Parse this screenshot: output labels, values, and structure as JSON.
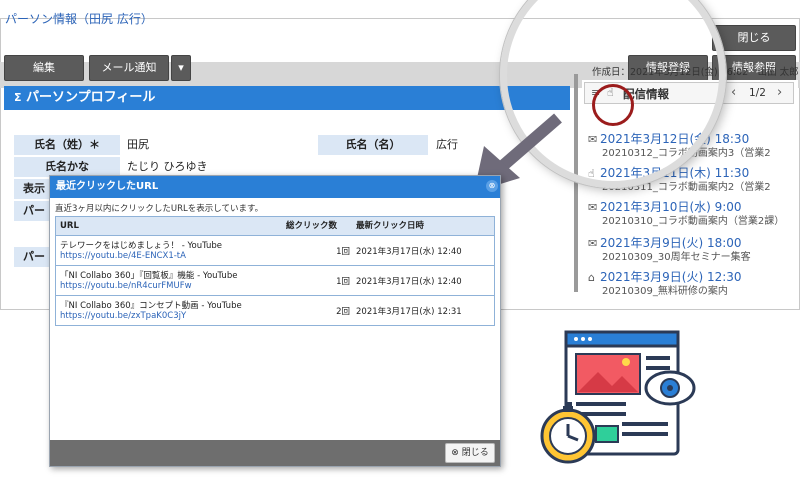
{
  "page": {
    "title": "パーソン情報（田尻 広行）"
  },
  "header": {
    "close_label": "閉じる",
    "edit_label": "編集",
    "mail_label": "メール通知",
    "info_register_label": "情報登録",
    "info_view_label": "情報参照"
  },
  "profile": {
    "heading": "パーソンプロフィール",
    "last_name_label": "氏名（姓）＊",
    "last_name_value": "田尻",
    "first_name_label": "氏名（名）",
    "first_name_value": "広行",
    "kana_label": "氏名かな",
    "kana_value": "たじり ひろゆき",
    "display_label": "表示",
    "p_label_1": "パー",
    "p_label_2": "パー"
  },
  "right_panel": {
    "updated": "作成日：2021年3月12日(金) 16:02　山田 太郎",
    "title": "配信情報",
    "page": "1/2",
    "items": [
      {
        "icon": "mail-icon",
        "time": "2021年3月12日(金) 18:30",
        "sub": "20210312_コラボ動画案内3（営業2"
      },
      {
        "icon": "click-icon",
        "time": "2021年3月11日(木) 11:30",
        "sub": "20210311_コラボ動画案内2（営業2"
      },
      {
        "icon": "mail-icon",
        "time": "2021年3月10日(水) 9:00",
        "sub": "20210310_コラボ動画案内（営業2課）"
      },
      {
        "icon": "mail-icon",
        "time": "2021年3月9日(火) 18:00",
        "sub": "20210309_30周年セミナー集客"
      },
      {
        "icon": "open-mail-icon",
        "time": "2021年3月9日(火) 12:30",
        "sub": "20210309_無料研修の案内"
      }
    ]
  },
  "modal": {
    "title": "最近クリックしたURL",
    "description": "直近3ヶ月以内にクリックしたURLを表示しています。",
    "columns": {
      "url": "URL",
      "count": "総クリック数",
      "date": "最新クリック日時"
    },
    "rows": [
      {
        "title": "テレワークをはじめましょう！ - YouTube",
        "url": "https://youtu.be/4E-ENCX1-tA",
        "count": "1回",
        "date": "2021年3月17日(水) 12:40"
      },
      {
        "title": "「NI Collabo 360」『回覧板』機能 - YouTube",
        "url": "https://youtu.be/nR4curFMUFw",
        "count": "1回",
        "date": "2021年3月17日(水) 12:40"
      },
      {
        "title": "『NI Collabo 360』コンセプト動画 - YouTube",
        "url": "https://youtu.be/zxTpaK0C3jY",
        "count": "2回",
        "date": "2021年3月17日(水) 12:31"
      }
    ],
    "close_label": "閉じる"
  },
  "colors": {
    "accent": "#2a7fd6",
    "dark_button": "#5b5b5b",
    "link": "#2c64b8",
    "arrow": "#6f6b7a"
  }
}
